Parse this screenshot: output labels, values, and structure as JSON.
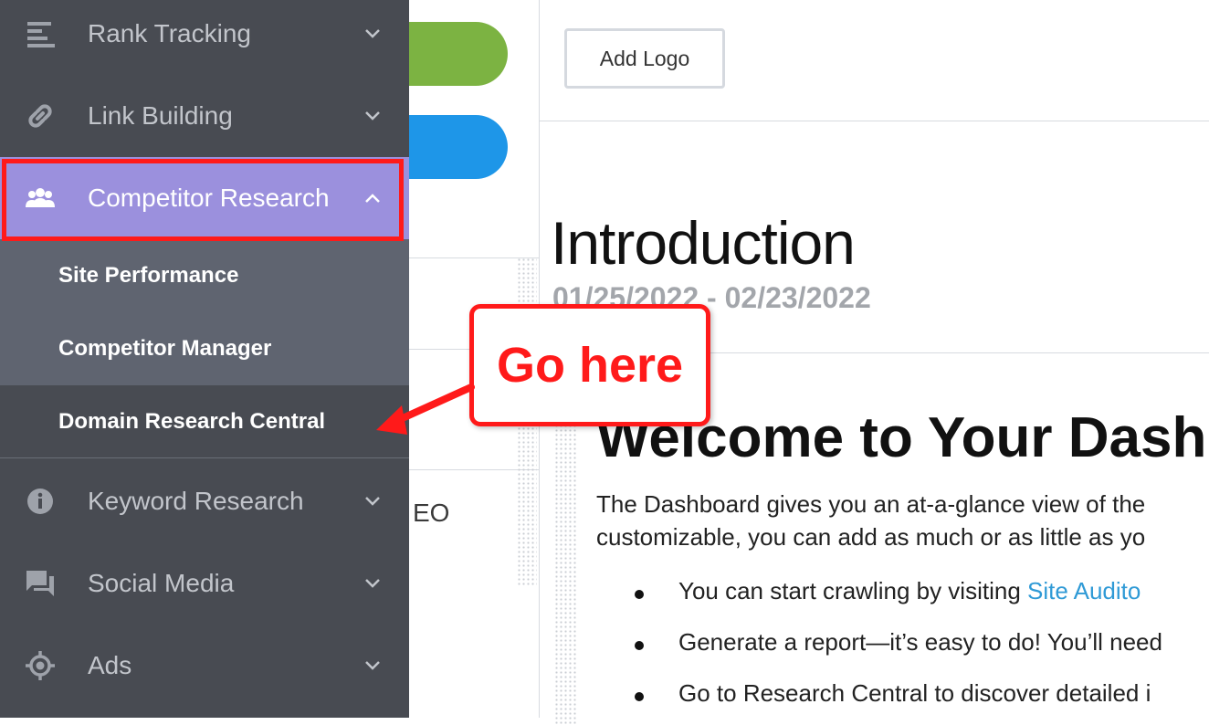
{
  "sidebar": {
    "items": [
      {
        "label": "Rank Tracking",
        "icon": "bar-list-icon"
      },
      {
        "label": "Link Building",
        "icon": "link-icon"
      },
      {
        "label": "Competitor Research",
        "icon": "users-icon"
      },
      {
        "label": "Keyword Research",
        "icon": "info-circle-icon"
      },
      {
        "label": "Social Media",
        "icon": "chat-icon"
      },
      {
        "label": "Ads",
        "icon": "target-icon"
      }
    ],
    "subitems": [
      "Site Performance",
      "Competitor Manager",
      "Domain Research Central"
    ]
  },
  "middle": {
    "partial_label": "EO"
  },
  "main": {
    "add_logo": "Add Logo",
    "title": "Introduction",
    "date_range": "01/25/2022 - 02/23/2022",
    "welcome": "Welcome to Your Dashb",
    "para_line1": "The Dashboard gives you an at-a-glance view of the",
    "para_line2": "customizable, you can add as much or as little as yo",
    "bullet1_text": "You can start crawling by visiting ",
    "bullet1_link": "Site Audito",
    "bullet2_text": "Generate a report—it’s easy to do! You’ll need",
    "bullet3_text": "Go to Research Central to discover detailed i"
  },
  "annotation": {
    "callout": "Go here"
  },
  "colors": {
    "highlight": "#ff1a1a",
    "active_nav": "#9b90dd",
    "sidebar_bg": "#484b52",
    "green": "#7cb342",
    "blue": "#1e96e8"
  }
}
